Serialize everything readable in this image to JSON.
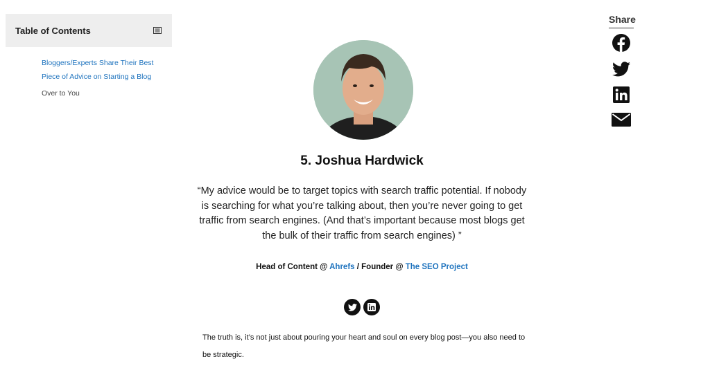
{
  "toc": {
    "title": "Table of Contents",
    "toggle_icon": "list-icon",
    "items": [
      {
        "label": "Bloggers/Experts Share Their Best Piece of Advice on Starting a Blog",
        "state": "link"
      },
      {
        "label": "Over to You",
        "state": "current"
      }
    ]
  },
  "share": {
    "title": "Share",
    "icons": [
      "facebook-icon",
      "twitter-icon",
      "linkedin-icon",
      "email-icon"
    ]
  },
  "expert": {
    "heading": "5. Joshua Hardwick",
    "avatar": "joshua-hardwick-portrait",
    "quote": "“My advice would be to target topics with search traffic potential. If nobody is searching for what you’re talking about, then you’re never going to get traffic from search engines. (And that’s important because most blogs get the bulk of their traffic from search engines) ”",
    "role_prefix": "Head of Content @ ",
    "company1": "Ahrefs",
    "role_middle": " / Founder @ ",
    "company2": "The SEO Project",
    "social_icons": [
      "twitter-icon",
      "linkedin-icon"
    ]
  },
  "body": {
    "paragraph": "The truth is, it’s not just about pouring your heart and soul on every blog post—you also need to be strategic."
  },
  "colors": {
    "link": "#1e73be",
    "toc_header_bg": "#eeeeee",
    "icon": "#111111"
  }
}
